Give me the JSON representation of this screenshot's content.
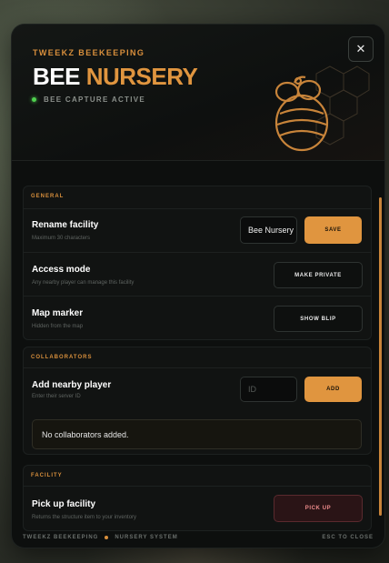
{
  "header": {
    "brand": "TWEEKZ BEEKEEPING",
    "title_part1": "BEE",
    "title_part2": "NURSERY",
    "status": "BEE CAPTURE ACTIVE",
    "close_glyph": "✕"
  },
  "sections": {
    "general": {
      "title": "GENERAL",
      "rename": {
        "label": "Rename facility",
        "sub": "Maximum 30 characters",
        "input_value": "Bee Nursery",
        "button": "SAVE"
      },
      "access": {
        "label": "Access mode",
        "sub": "Any nearby player can manage this facility",
        "button": "MAKE PRIVATE"
      },
      "marker": {
        "label": "Map marker",
        "sub": "Hidden from the map",
        "button": "SHOW BLIP"
      }
    },
    "collaborators": {
      "title": "COLLABORATORS",
      "add": {
        "label": "Add nearby player",
        "sub": "Enter their server ID",
        "placeholder": "ID",
        "button": "ADD"
      },
      "empty": "No collaborators added."
    },
    "facility": {
      "title": "FACILITY",
      "pickup": {
        "label": "Pick up facility",
        "sub": "Returns the structure item to your inventory",
        "button": "PICK UP"
      }
    }
  },
  "footer": {
    "left1": "TWEEKZ BEEKEEPING",
    "left2": "NURSERY SYSTEM",
    "right": "ESC TO CLOSE"
  },
  "colors": {
    "accent": "#e0953f",
    "status_green": "#4fd14f",
    "danger": "#ef8c8c"
  },
  "icons": [
    "close-icon",
    "beehive-icon",
    "status-dot-icon"
  ]
}
